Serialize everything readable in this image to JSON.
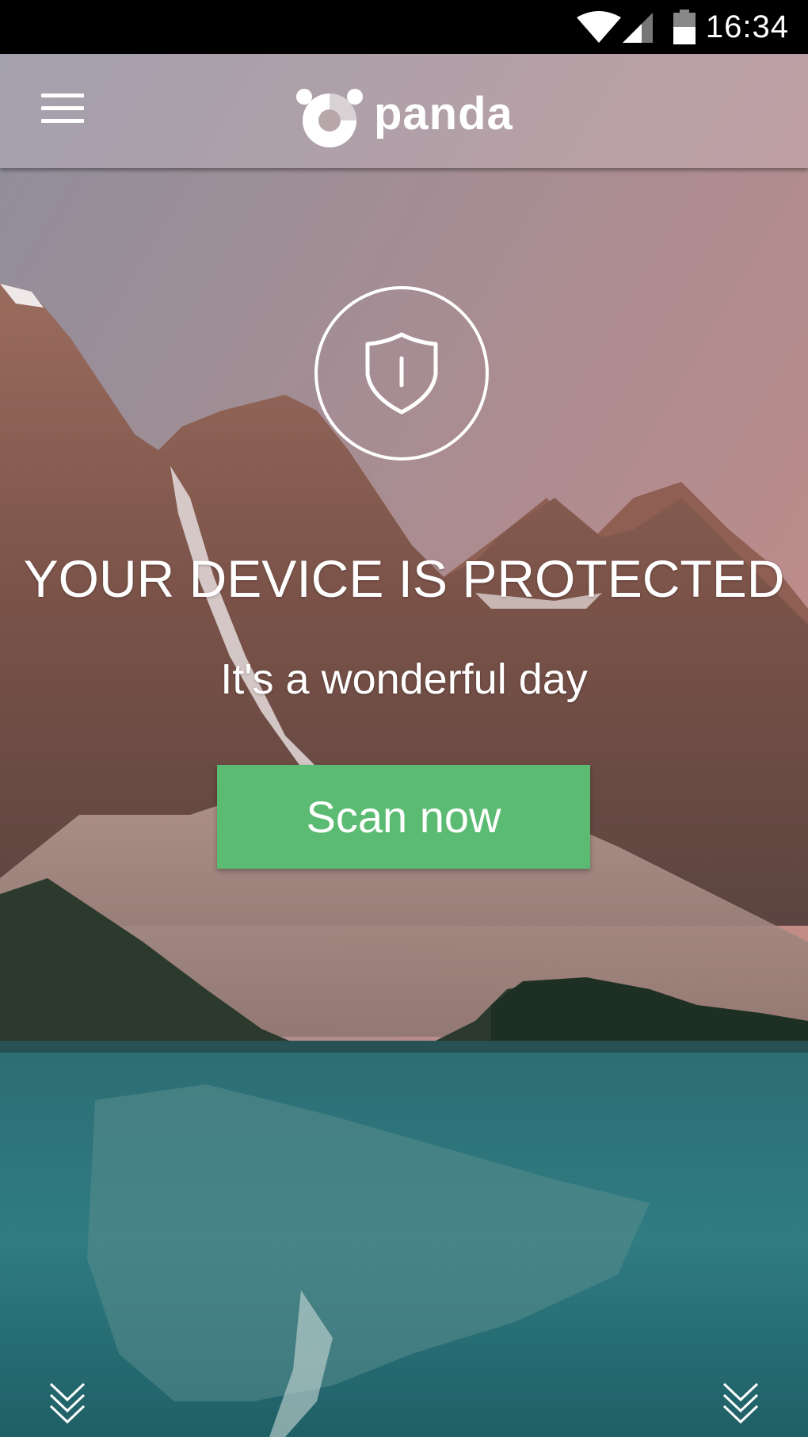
{
  "status_bar": {
    "time": "16:34",
    "icons": [
      "wifi-icon",
      "cell-signal-icon",
      "battery-icon"
    ]
  },
  "app_bar": {
    "menu_icon": "hamburger-menu-icon",
    "logo_text": "panda"
  },
  "main": {
    "status_icon": "shield-icon",
    "headline": "YOUR DEVICE IS PROTECTED",
    "subline": "It's a wonderful day",
    "scan_button_label": "Scan now"
  },
  "footer": {
    "left_icon": "double-chevron-down-icon",
    "right_icon": "double-chevron-down-icon"
  },
  "colors": {
    "accent": "#5cbb72",
    "status_bar_bg": "#000000",
    "text": "#ffffff"
  }
}
